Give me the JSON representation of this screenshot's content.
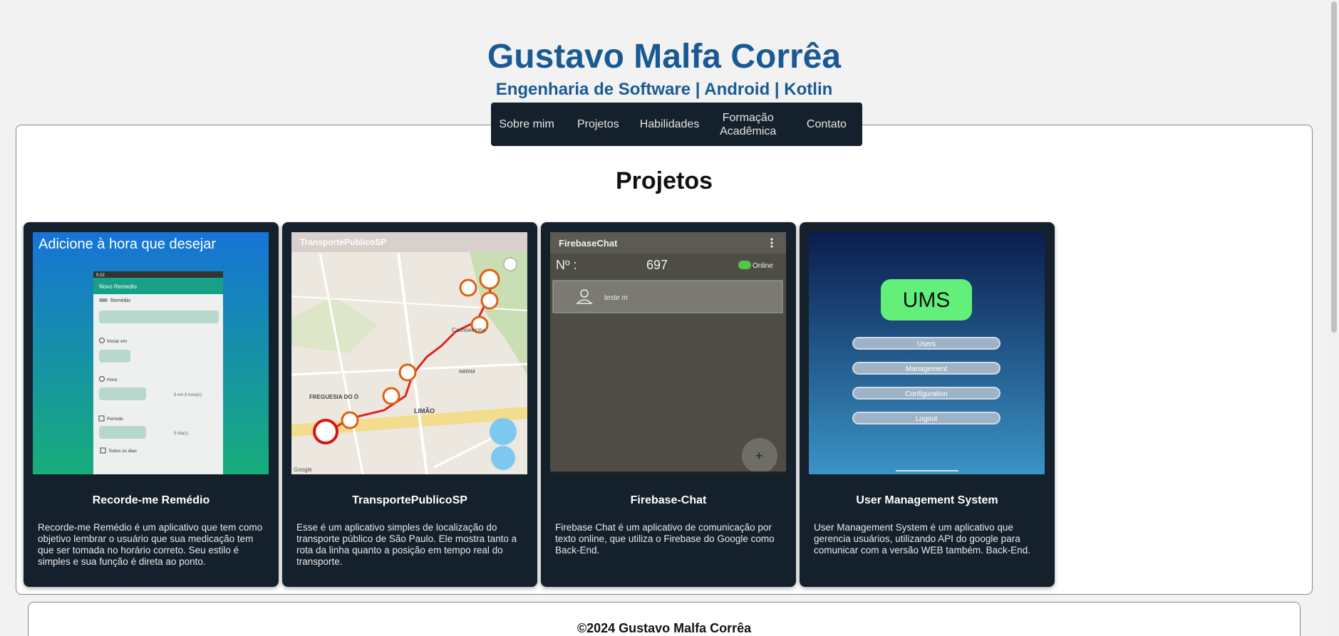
{
  "header": {
    "name": "Gustavo Malfa Corrêa",
    "tagline": "Engenharia de Software | Android | Kotlin"
  },
  "nav": {
    "items": [
      {
        "label": "Sobre mim"
      },
      {
        "label": "Projetos"
      },
      {
        "label": "Habilidades"
      },
      {
        "label": "Formação Acadêmica"
      },
      {
        "label": "Contato"
      }
    ]
  },
  "section": {
    "title": "Projetos"
  },
  "projects": [
    {
      "title": "Recorde-me Remédio",
      "description": "Recorde-me Remédio é um aplicativo que tem como objetivo lembrar o usuário que sua medicação tem que ser tomada no horário correto. Seu estilo é simples e sua função é direta ao ponto.",
      "screenshot": {
        "heading": "Adicione à hora que desejar",
        "appbar": "Novo Remedio",
        "field_remedio": "Remédio",
        "field_iniciar": "Iniciar em",
        "field_hora": "Hora",
        "hora_note": "8 em 8 hora(s)",
        "field_periodo": "Período",
        "periodo_note": "5 dia(s)",
        "todos": "Todos os dias",
        "status_time": "5:22"
      }
    },
    {
      "title": "TransportePublicoSP",
      "description": "Esse é um aplicativo simples de localização do transporte público de São Paulo. Ele mostra tanto a rota da linha quanto a posição em tempo real do transporte.",
      "screenshot": {
        "appbar": "TransportePublicoSP",
        "map_labels": [
          "Cachoeirinha",
          "LIMÃO",
          "FREGUESIA DO Ó",
          "IMIRIM",
          "Google"
        ]
      }
    },
    {
      "title": "Firebase-Chat",
      "description": "Firebase Chat é um aplicativo de comunicação por texto online, que utiliza o Firebase do Google como Back-End.",
      "screenshot": {
        "appbar": "FirebaseChat",
        "count_label": "Nº :",
        "count_value": "697",
        "status": "Online",
        "user": "teste m"
      }
    },
    {
      "title": "User Management System",
      "description": "User Management System é um aplicativo que gerencia usuários, utilizando API do google para comunicar com a versão WEB também. Back-End.",
      "screenshot": {
        "logo": "UMS",
        "buttons": [
          "Users",
          "Management",
          "Configuration",
          "Logout"
        ]
      }
    }
  ],
  "footer": {
    "copyright": "©2024 Gustavo Malfa Corrêa"
  },
  "colors": {
    "brand": "#1a5a94",
    "card_bg": "#14202c",
    "page_bg": "#f2f2f2"
  }
}
